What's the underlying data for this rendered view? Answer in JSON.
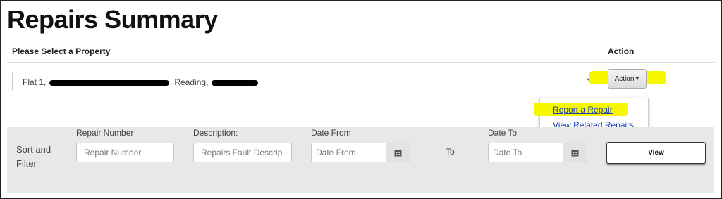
{
  "page": {
    "title": "Repairs Summary"
  },
  "property": {
    "label": "Please Select a Property",
    "selected_prefix": "Flat 1,",
    "selected_middle": ", Reading,"
  },
  "action": {
    "label": "Action",
    "button_label": "Action",
    "menu_items": [
      "Report a Repair",
      "View Related Repairs"
    ],
    "highlight_color": "#f7f700"
  },
  "filter": {
    "section_label": "Sort and Filter",
    "repair_number": {
      "label": "Repair Number",
      "placeholder": "Repair Number"
    },
    "description": {
      "label": "Description:",
      "placeholder": "Repairs Fault Descrip"
    },
    "date_from": {
      "label": "Date From",
      "placeholder": "Date From"
    },
    "to_label": "To",
    "date_to": {
      "label": "Date To",
      "placeholder": "Date To"
    },
    "view_button": "View"
  }
}
